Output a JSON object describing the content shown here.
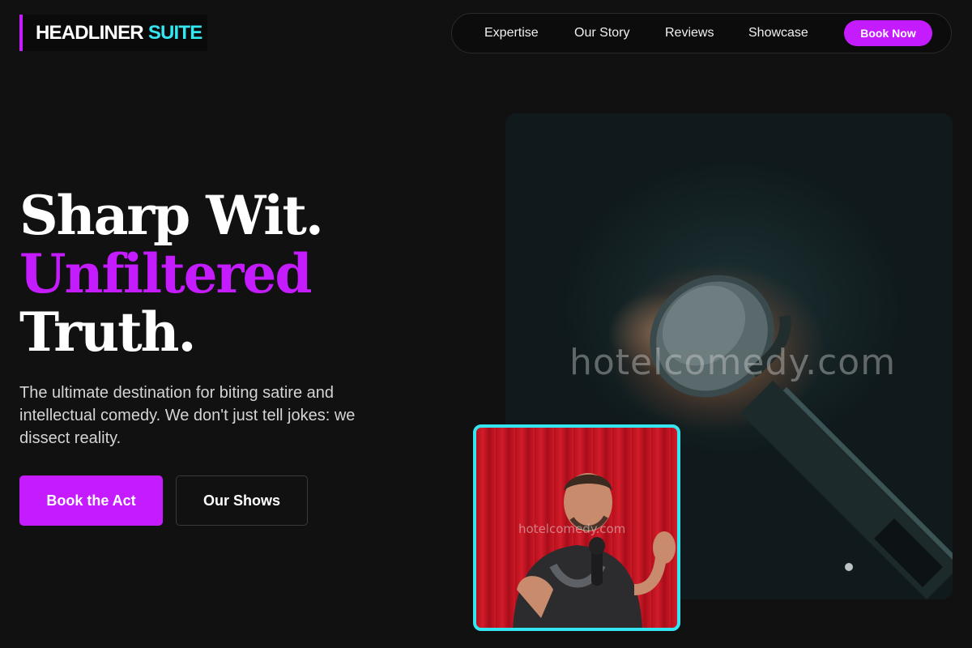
{
  "brand": {
    "part1": "HEADLINER",
    "part2": "SUITE"
  },
  "nav": {
    "links": [
      "Expertise",
      "Our Story",
      "Reviews",
      "Showcase"
    ],
    "cta": "Book Now"
  },
  "hero": {
    "line1": "Sharp Wit.",
    "line2": "Unfiltered",
    "line3": "Truth.",
    "lead": "The ultimate destination for biting satire and intellectual comedy. We don't just tell jokes: we dissect reality.",
    "primary_button": "Book the Act",
    "secondary_button": "Our Shows"
  },
  "images": {
    "mic_watermark": "hotelcomedy.com",
    "performer_watermark": "hotelcomedy.com"
  },
  "colors": {
    "accent": "#c51bff",
    "cyan": "#33e6ef",
    "background": "#111112"
  }
}
